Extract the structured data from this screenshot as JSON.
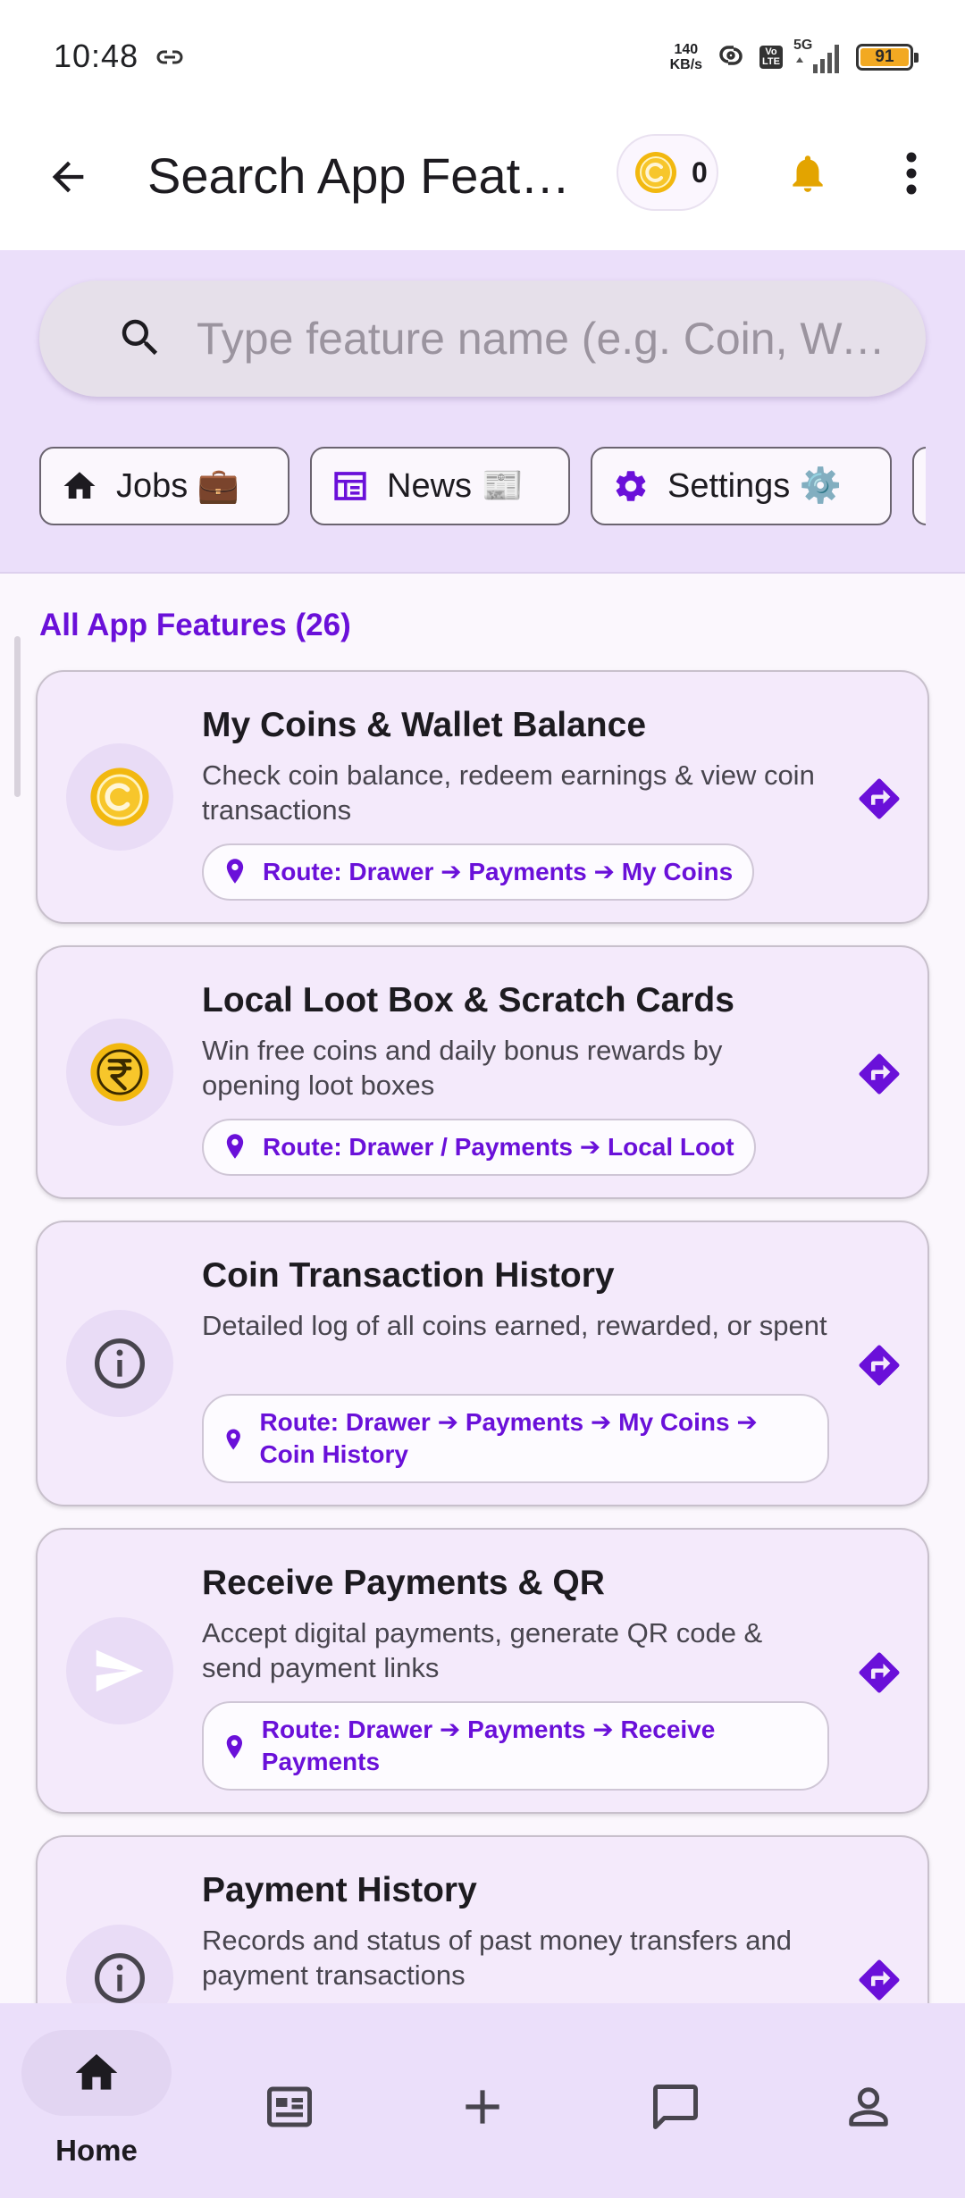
{
  "status_bar": {
    "time": "10:48",
    "net_speed_value": "140",
    "net_speed_unit": "KB/s",
    "volte_top": "Vo",
    "volte_bottom": "LTE",
    "network": "5G",
    "battery": "91"
  },
  "app_bar": {
    "title": "Search App Features",
    "coin_count": "0"
  },
  "search": {
    "placeholder": "Type feature name (e.g. Coin, Wallet, Jobs)"
  },
  "chips": [
    {
      "label": "Jobs 💼",
      "icon": "home-icon"
    },
    {
      "label": "News 📰",
      "icon": "newspaper-icon"
    },
    {
      "label": "Settings ⚙️",
      "icon": "gear-icon"
    }
  ],
  "section": {
    "title": "All App Features (26)"
  },
  "features": [
    {
      "title": "My Coins & Wallet Balance",
      "description": "Check coin balance, redeem earnings & view coin transactions",
      "route": "Route: Drawer ➔ Payments ➔ My Coins",
      "icon": "coin-icon"
    },
    {
      "title": "Local Loot Box & Scratch Cards",
      "description": "Win free coins and daily bonus rewards by opening loot boxes",
      "route": "Route: Drawer / Payments ➔ Local Loot",
      "icon": "rupee-coin-icon"
    },
    {
      "title": "Coin Transaction History",
      "description": "Detailed log of all coins earned, rewarded, or spent",
      "route": "Route: Drawer ➔ Payments ➔ My Coins ➔ Coin History",
      "icon": "info-icon"
    },
    {
      "title": "Receive Payments & QR",
      "description": "Accept digital payments, generate QR code & send payment links",
      "route": "Route: Drawer ➔ Payments ➔ Receive Payments",
      "icon": "send-icon"
    },
    {
      "title": "Payment History",
      "description": "Records and status of past money transfers and payment transactions",
      "route": "",
      "icon": "info-icon"
    }
  ],
  "bottom_nav": {
    "home_label": "Home"
  },
  "colors": {
    "accent": "#6a10d9",
    "coin_gold": "#f2b80f",
    "bell": "#e3a400",
    "panel": "#ebdffa",
    "card": "#f4eafb"
  }
}
